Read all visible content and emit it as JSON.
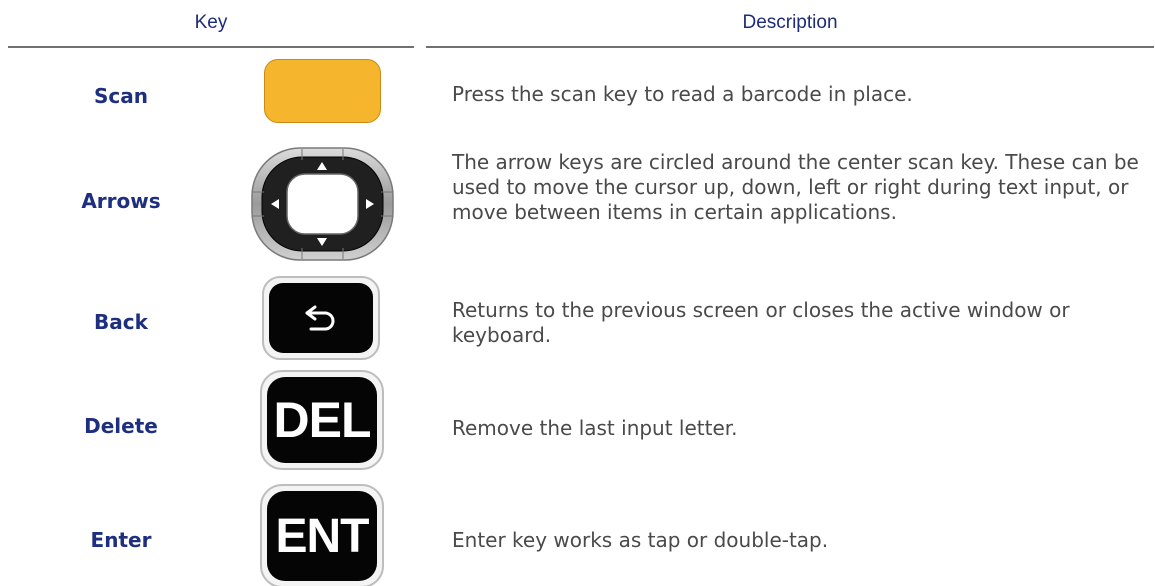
{
  "header": {
    "key": "Key",
    "description": "Description"
  },
  "rows": [
    {
      "key": "Scan",
      "icon": "scan-key-icon",
      "description": "Press the scan key to read a barcode in place."
    },
    {
      "key": "Arrows",
      "icon": "arrow-keys-icon",
      "description": "The arrow keys are circled around the center scan key. These can be used to move the cursor up, down, left or right during text input, or move between items in certain applications."
    },
    {
      "key": "Back",
      "icon": "back-arrow-icon",
      "description": "Returns to the previous screen or closes the active window or keyboard."
    },
    {
      "key": "Delete",
      "icon": "del-key-icon",
      "key_text": "DEL",
      "description": "Remove the last input letter."
    },
    {
      "key": "Enter",
      "icon": "ent-key-icon",
      "key_text": "ENT",
      "description": "Enter key works as tap or double-tap."
    }
  ],
  "colors": {
    "scan_key": "#f5b52c",
    "key_label": "#1f2f7f",
    "header_text": "#1d2b7a",
    "description_text": "#4a4a4a"
  }
}
